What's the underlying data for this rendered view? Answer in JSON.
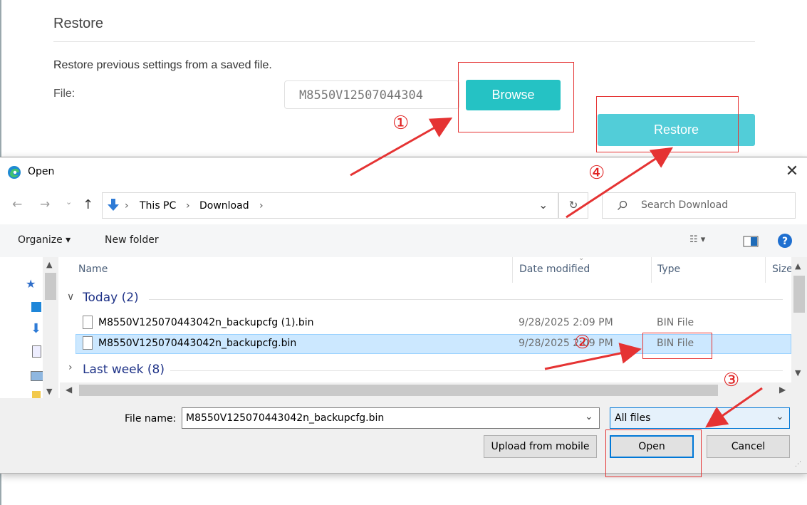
{
  "page": {
    "section_title": "Restore",
    "description": "Restore previous settings from a saved file.",
    "file_label": "File:",
    "file_value": "M8550V12507044304",
    "browse_label": "Browse",
    "restore_label": "Restore"
  },
  "dialog": {
    "title": "Open",
    "breadcrumb": [
      "This PC",
      "Download"
    ],
    "search_placeholder": "Search Download",
    "toolbar": {
      "organize": "Organize ▾",
      "new_folder": "New folder"
    },
    "columns": [
      "Name",
      "Date modified",
      "Type",
      "Size"
    ],
    "groups": [
      {
        "label": "Today (2)",
        "expanded": true
      },
      {
        "label": "Last week (8)",
        "expanded": false
      }
    ],
    "files": [
      {
        "name": "M8550V125070443042n_backupcfg (1).bin",
        "date": "9/28/2025 2:09 PM",
        "type": "BIN File",
        "selected": false
      },
      {
        "name": "M8550V125070443042n_backupcfg.bin",
        "date": "9/28/2025 2:09 PM",
        "type": "BIN File",
        "selected": true
      }
    ],
    "file_name_label": "File name:",
    "file_name_value": "M8550V125070443042n_backupcfg.bin",
    "file_type": "All files",
    "upload_mobile": "Upload from mobile",
    "open": "Open",
    "cancel": "Cancel"
  },
  "annotations": {
    "steps": [
      "①",
      "②",
      "③",
      "④"
    ],
    "color": "#e53333"
  },
  "icons": [
    "edge-icon",
    "close-icon",
    "back-arrow-icon",
    "forward-arrow-icon",
    "up-arrow-icon",
    "download-folder-icon",
    "refresh-icon",
    "search-icon",
    "view-icon",
    "preview-pane-icon",
    "help-icon",
    "file-icon",
    "pin-icon"
  ]
}
